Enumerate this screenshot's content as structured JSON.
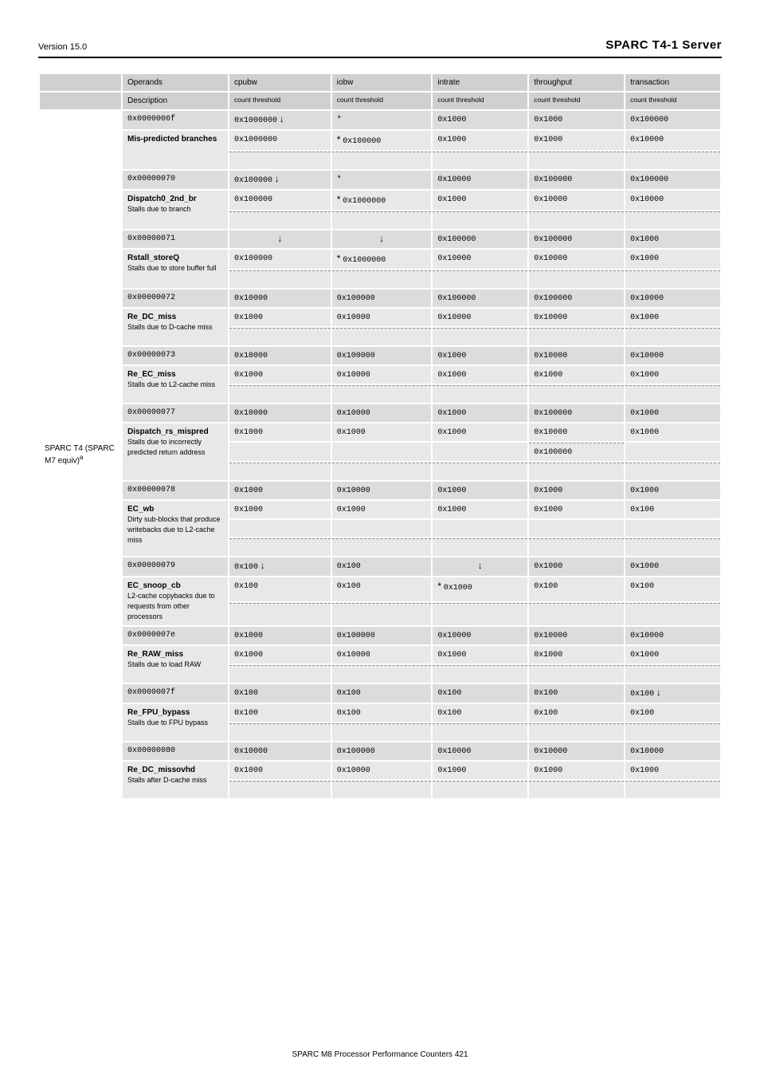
{
  "header": {
    "left": "Version 15.0",
    "right": "SPARC T4-1 Server"
  },
  "cols": [
    "Operands",
    "Description",
    "cpubw",
    "iobw",
    "intrate",
    "throughput",
    "transaction"
  ],
  "rows": [
    {
      "op": "0x0000006f",
      "desc": "Mis-predicted branches",
      "cells": [
        {
          "v": "0x1000000 ↓"
        },
        {
          "s": true,
          "v": "* 0x100000"
        },
        {
          "v": "0x1000 0x1000"
        },
        {
          "v": "0x1000 0x1000"
        },
        {
          "v": "0x100000 0x10000"
        }
      ]
    },
    {
      "op": "0x00000070",
      "desc": "Dispatch0_2nd_br",
      "note": "Stalls due to branch",
      "cells": [
        {
          "v": "0x100000 ↓"
        },
        {
          "s": true,
          "v": "* 0x1000000"
        },
        {
          "v": "0x10000 0x1000"
        },
        {
          "v": "0x100000 0x10000"
        },
        {
          "v": "0x100000 0x10000"
        }
      ]
    },
    {
      "op": "0x00000071",
      "desc": "Rstall_storeQ",
      "note": "Stalls due to store buffer full",
      "cells": [
        {
          "v": "0x100000 ↓",
          "s2": true
        },
        {
          "s": true,
          "v": "* 0x1000000"
        },
        {
          "v": "0x100000 0x10000"
        },
        {
          "v": "0x100000 0x10000"
        },
        {
          "v": "0x1000 0x1000"
        }
      ],
      "extracol": 2
    },
    {
      "op": "0x00000072",
      "desc": "Re_DC_miss",
      "note": "Stalls due to D-cache miss",
      "cells": [
        {
          "v": "0x10000 0x1000"
        },
        {
          "v": "0x100000 0x10000"
        },
        {
          "v": "0x100000 0x10000"
        },
        {
          "v": "0x100000 0x10000"
        },
        {
          "v": "0x10000 0x1000"
        }
      ]
    },
    {
      "op": "0x00000073",
      "desc": "Re_EC_miss",
      "note": "Stalls due to L2-cache miss",
      "cells": [
        {
          "v": "0x10000 0x1000"
        },
        {
          "v": "0x100000 0x10000"
        },
        {
          "v": "0x1000 0x1000"
        },
        {
          "v": "0x10000 0x1000"
        },
        {
          "v": "0x10000 0x1000"
        }
      ]
    },
    {
      "op": "0x00000077",
      "desc": "Dispatch_rs_mispred",
      "note": "Stalls due to incorrectly predicted return address",
      "cells": [
        {
          "v": "0x10000 0x1000"
        },
        {
          "v": "0x10000 0x1000"
        },
        {
          "v": "0x1000 0x1000"
        },
        {
          "v": "0x100000 0x10000",
          "mid": true
        },
        {
          "v": "0x1000 0x1000"
        }
      ],
      "tall": true
    },
    {
      "op": "0x00000078",
      "desc": "EC_wb",
      "note": "Dirty sub-blocks that produce writebacks due to L2-cache miss",
      "cells": [
        {
          "v": "0x1000 0x1000"
        },
        {
          "v": "0x10000 0x1000"
        },
        {
          "v": "0x1000 0x1000"
        },
        {
          "v": "0x1000 0x1000"
        },
        {
          "v": "0x1000 0x100"
        }
      ],
      "tall": true
    },
    {
      "op": "0x00000079",
      "desc": "EC_snoop_cb",
      "note": "L2-cache copybacks due to requests from other processors",
      "cells": [
        {
          "v": "0x100 ↓"
        },
        {
          "v": "0x100 0x100"
        },
        {
          "s": true,
          "v": "* 0x1000",
          "s3": true
        },
        {
          "v": "0x1000 0x100"
        },
        {
          "v": "0x1000 0x100"
        }
      ],
      "extracol": 3
    },
    {
      "op": "0x0000007e",
      "desc": "Re_RAW_miss",
      "note": "Stalls due to load RAW",
      "cells": [
        {
          "v": "0x1000 0x1000"
        },
        {
          "v": "0x100000 0x10000"
        },
        {
          "v": "0x10000 0x1000"
        },
        {
          "v": "0x10000 0x1000"
        },
        {
          "v": "0x10000 0x1000"
        }
      ]
    },
    {
      "op": "0x0000007f",
      "desc": "Re_FPU_bypass",
      "note": "Stalls due to FPU bypass",
      "cells": [
        {
          "v": "0x100 0x100"
        },
        {
          "v": "0x100 0x100"
        },
        {
          "v": "0x100 0x100"
        },
        {
          "v": "0x100 0x100"
        },
        {
          "v": "0x100 ↓"
        }
      ]
    },
    {
      "op": "0x00000080",
      "desc": "Re_DC_missovhd",
      "note": "Stalls after D-cache miss",
      "cells": [
        {
          "v": "0x10000 0x1000"
        },
        {
          "v": "0x100000 0x10000"
        },
        {
          "v": "0x10000 0x1000"
        },
        {
          "v": "0x10000 0x1000"
        },
        {
          "v": "0x10000 0x1000"
        }
      ]
    }
  ],
  "grouplabel": "SPARC T4 (SPARC<br>M7 equiv)<sup>a</sup>",
  "footer": "SPARC M8 Processor Performance Counters   421"
}
